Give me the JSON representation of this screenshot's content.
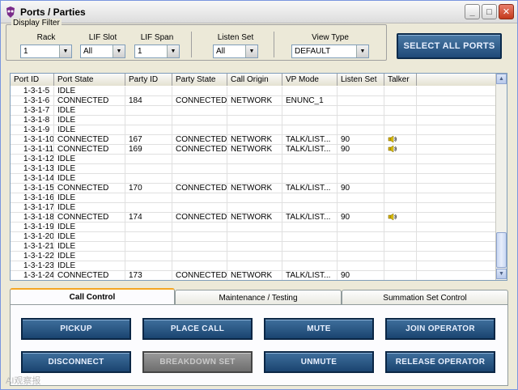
{
  "window": {
    "title": "Ports / Parties"
  },
  "filter": {
    "legend": "Display Filter",
    "fields": [
      {
        "label": "Rack",
        "value": "1"
      },
      {
        "label": "LIF Slot",
        "value": "All"
      },
      {
        "label": "LIF Span",
        "value": "1"
      },
      {
        "label": "Listen Set",
        "value": "All"
      },
      {
        "label": "View Type",
        "value": "DEFAULT"
      }
    ]
  },
  "select_all_label": "SELECT ALL PORTS",
  "table": {
    "columns": [
      "Port ID",
      "Port State",
      "Party ID",
      "Party State",
      "Call Origin",
      "VP Mode",
      "Listen Set",
      "Talker"
    ],
    "rows": [
      [
        "1-3-1-5",
        "IDLE",
        "",
        "",
        "",
        "",
        "",
        ""
      ],
      [
        "1-3-1-6",
        "CONNECTED",
        "184",
        "CONNECTED",
        "NETWORK",
        "ENUNC_1",
        "",
        ""
      ],
      [
        "1-3-1-7",
        "IDLE",
        "",
        "",
        "",
        "",
        "",
        ""
      ],
      [
        "1-3-1-8",
        "IDLE",
        "",
        "",
        "",
        "",
        "",
        ""
      ],
      [
        "1-3-1-9",
        "IDLE",
        "",
        "",
        "",
        "",
        "",
        ""
      ],
      [
        "1-3-1-10",
        "CONNECTED",
        "167",
        "CONNECTED",
        "NETWORK",
        "TALK/LIST...",
        "90",
        "speaker-icon"
      ],
      [
        "1-3-1-11",
        "CONNECTED",
        "169",
        "CONNECTED",
        "NETWORK",
        "TALK/LIST...",
        "90",
        "speaker-icon"
      ],
      [
        "1-3-1-12",
        "IDLE",
        "",
        "",
        "",
        "",
        "",
        ""
      ],
      [
        "1-3-1-13",
        "IDLE",
        "",
        "",
        "",
        "",
        "",
        ""
      ],
      [
        "1-3-1-14",
        "IDLE",
        "",
        "",
        "",
        "",
        "",
        ""
      ],
      [
        "1-3-1-15",
        "CONNECTED",
        "170",
        "CONNECTED",
        "NETWORK",
        "TALK/LIST...",
        "90",
        ""
      ],
      [
        "1-3-1-16",
        "IDLE",
        "",
        "",
        "",
        "",
        "",
        ""
      ],
      [
        "1-3-1-17",
        "IDLE",
        "",
        "",
        "",
        "",
        "",
        ""
      ],
      [
        "1-3-1-18",
        "CONNECTED",
        "174",
        "CONNECTED",
        "NETWORK",
        "TALK/LIST...",
        "90",
        "speaker-icon"
      ],
      [
        "1-3-1-19",
        "IDLE",
        "",
        "",
        "",
        "",
        "",
        ""
      ],
      [
        "1-3-1-20",
        "IDLE",
        "",
        "",
        "",
        "",
        "",
        ""
      ],
      [
        "1-3-1-21",
        "IDLE",
        "",
        "",
        "",
        "",
        "",
        ""
      ],
      [
        "1-3-1-22",
        "IDLE",
        "",
        "",
        "",
        "",
        "",
        ""
      ],
      [
        "1-3-1-23",
        "IDLE",
        "",
        "",
        "",
        "",
        "",
        ""
      ],
      [
        "1-3-1-24",
        "CONNECTED",
        "173",
        "CONNECTED",
        "NETWORK",
        "TALK/LIST...",
        "90",
        ""
      ]
    ]
  },
  "tabs": [
    "Call Control",
    "Maintenance / Testing",
    "Summation Set Control"
  ],
  "actions": [
    {
      "label": "PICKUP",
      "enabled": true
    },
    {
      "label": "PLACE CALL",
      "enabled": true
    },
    {
      "label": "MUTE",
      "enabled": true
    },
    {
      "label": "JOIN OPERATOR",
      "enabled": true
    },
    {
      "label": "DISCONNECT",
      "enabled": true
    },
    {
      "label": "BREAKDOWN SET",
      "enabled": false
    },
    {
      "label": "UNMUTE",
      "enabled": true
    },
    {
      "label": "RELEASE OPERATOR",
      "enabled": true
    }
  ],
  "watermark": "AI观察报",
  "colors": {
    "button_blue": "#1f4a78",
    "accent_tab": "#f5a623",
    "speaker": "#d4b000"
  }
}
